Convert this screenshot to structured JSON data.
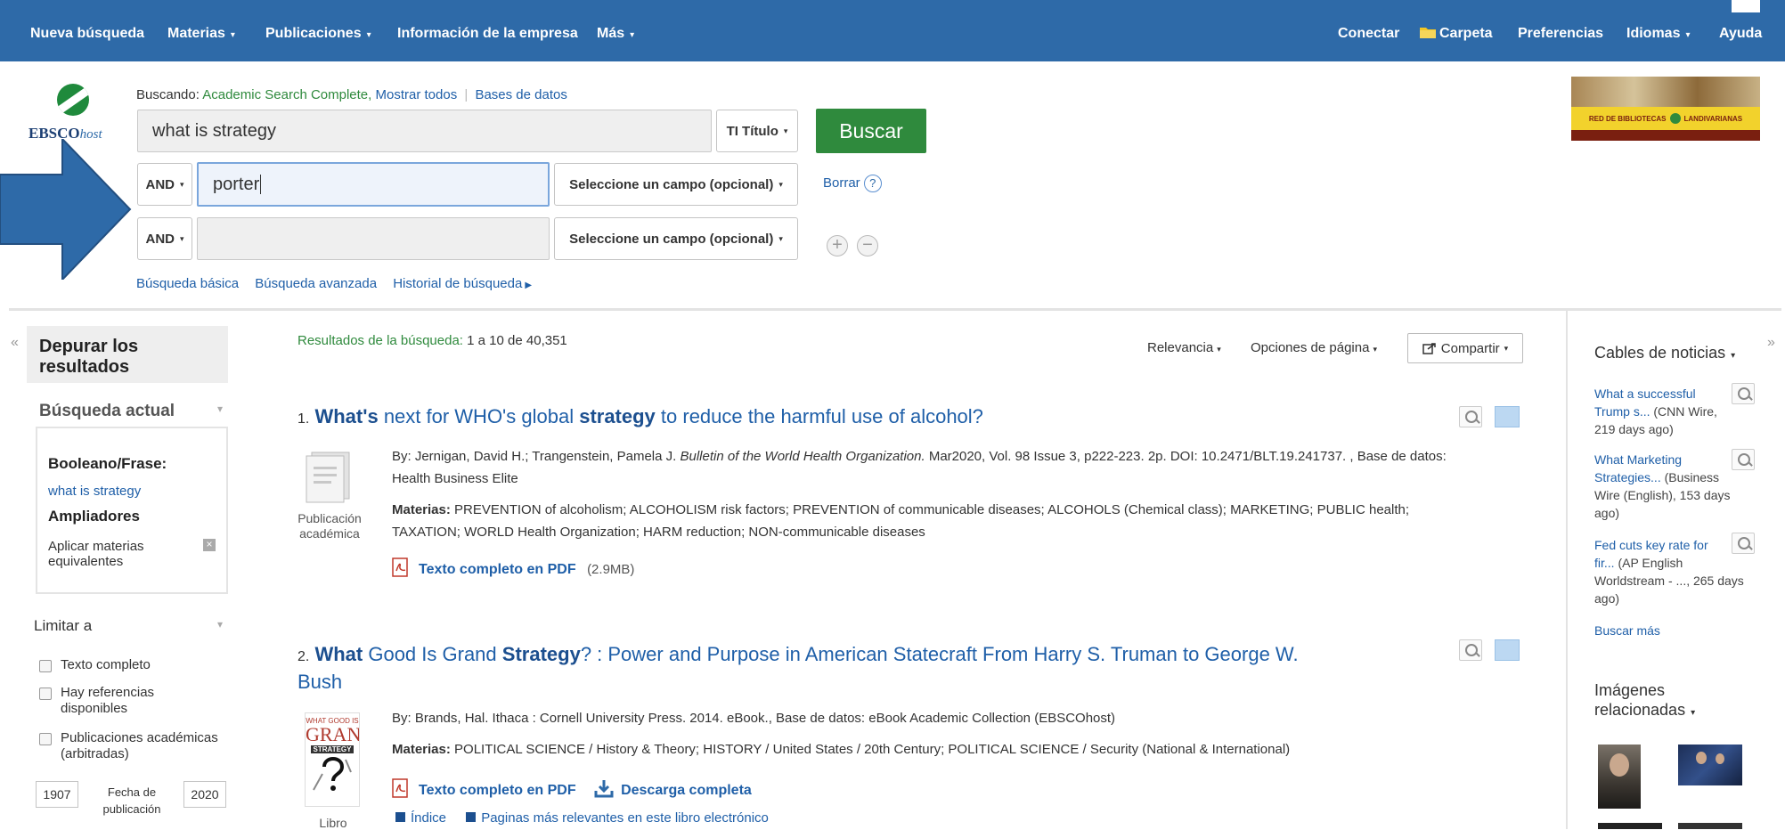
{
  "nav": {
    "left": [
      "Nueva búsqueda",
      "Materias",
      "Publicaciones",
      "Información de la empresa",
      "Más"
    ],
    "right": [
      "Conectar",
      "Carpeta",
      "Preferencias",
      "Idiomas",
      "Ayuda"
    ],
    "caret": "▾"
  },
  "logo": {
    "ebsco": "EBSCO",
    "host": "host"
  },
  "searching": {
    "label": "Buscando:",
    "db": "Academic Search Complete,",
    "show_all": "Mostrar todos",
    "databases": "Bases de datos"
  },
  "search": {
    "row1_value": "what is strategy",
    "row1_field": "TI Título",
    "row2_op": "AND",
    "row2_value": "porter",
    "row2_field": "Seleccione un campo (opcional)",
    "row3_op": "AND",
    "row3_value": "",
    "row3_field": "Seleccione un campo (opcional)",
    "search_button": "Buscar",
    "clear": "Borrar",
    "help": "?",
    "add": "+",
    "remove": "−"
  },
  "search_links": {
    "basic": "Búsqueda básica",
    "advanced": "Búsqueda avanzada",
    "history": "Historial de búsqueda"
  },
  "library_logo": {
    "text": "RED DE BIBLIOTECAS",
    "brand": "LANDIVARIANAS"
  },
  "left": {
    "collapse": "«",
    "refine": "Depurar los resultados",
    "current_search": "Búsqueda actual",
    "boolean": "Booleano/Frase:",
    "query": "what is strategy",
    "expanders": "Ampliadores",
    "apply_subjects": "Aplicar materias equivalentes",
    "remove_x": "×",
    "limit": "Limitar a",
    "limiters": [
      "Texto completo",
      "Hay referencias disponibles",
      "Publicaciones académicas (arbitradas)"
    ],
    "year_from": "1907",
    "year_to": "2020",
    "date_label": "Fecha de publicación"
  },
  "results": {
    "summary_label": "Resultados de la búsqueda:",
    "summary_value": "1 a 10 de 40,351",
    "relevance": "Relevancia",
    "page_options": "Opciones de página",
    "share": "Compartir",
    "items": [
      {
        "num": "1.",
        "t1": "What's",
        "t2": " next for WHO's global ",
        "t3": "strategy",
        "t4": " to reduce the harmful use of alcohol?",
        "byline_a": "By: Jernigan, David H.; Trangenstein, Pamela J. ",
        "journal": "Bulletin of the World Health Organization.",
        "byline_b": " Mar2020, Vol. 98 Issue 3, p222-223. 2p. DOI: 10.2471/BLT.19.241737. , Base de datos:",
        "byline_c": "Health Business Elite",
        "subjects_label": "Materias:",
        "subjects_a": " PREVENTION of alcoholism; ALCOHOLISM risk factors; PREVENTION of communicable diseases; ALCOHOLS (Chemical class); MARKETING; PUBLIC health;",
        "subjects_b": "TAXATION; WORLD Health Organization; HARM reduction; NON-communicable diseases",
        "type": "Publicación académica",
        "pdf": "Texto completo en PDF",
        "pdf_size": "(2.9MB)"
      },
      {
        "num": "2.",
        "t1": "What",
        "t2": " Good Is Grand ",
        "t3": "Strategy",
        "t4": "? : Power and Purpose in American Statecraft From Harry S. Truman to George W.",
        "t5": "Bush",
        "byline": "By: Brands, Hal. Ithaca : Cornell University Press. 2014. eBook., Base de datos: eBook Academic Collection (EBSCOhost)",
        "subjects_label": "Materias:",
        "subjects": " POLITICAL SCIENCE / History & Theory; HISTORY / United States / 20th Century; POLITICAL SCIENCE / Security (National & International)",
        "cover_top": "WHAT GOOD IS",
        "cover_mid": "GRAND",
        "cover_bot": "STRATEGY",
        "type": "Libro",
        "pdf": "Texto completo en PDF",
        "download": "Descarga completa",
        "index": "Índice",
        "pages": "Paginas más relevantes en este libro electrónico"
      }
    ]
  },
  "right": {
    "collapse": "»",
    "news_title": "Cables de noticias",
    "news": [
      {
        "l1": "What a successful",
        "l2": "Trump s...",
        "src": " (CNN Wire,",
        "src2": "219 days ago)"
      },
      {
        "l1": "What Marketing",
        "l2": "Strategies...",
        "src": " (Business",
        "src2": "Wire (English), 153 days",
        "src3": "ago)"
      },
      {
        "l1": "Fed cuts key rate for",
        "l2": "fir...",
        "src": " (AP English",
        "src2": "Worldstream - ..., 265 days",
        "src3": "ago)"
      }
    ],
    "more": "Buscar más",
    "images_title": "Imágenes relacionadas"
  },
  "colors": {
    "nav": "#2e6aa8",
    "button": "#2f8a3d",
    "link": "#1f5fa8",
    "arrow": "#2e6aa8"
  }
}
